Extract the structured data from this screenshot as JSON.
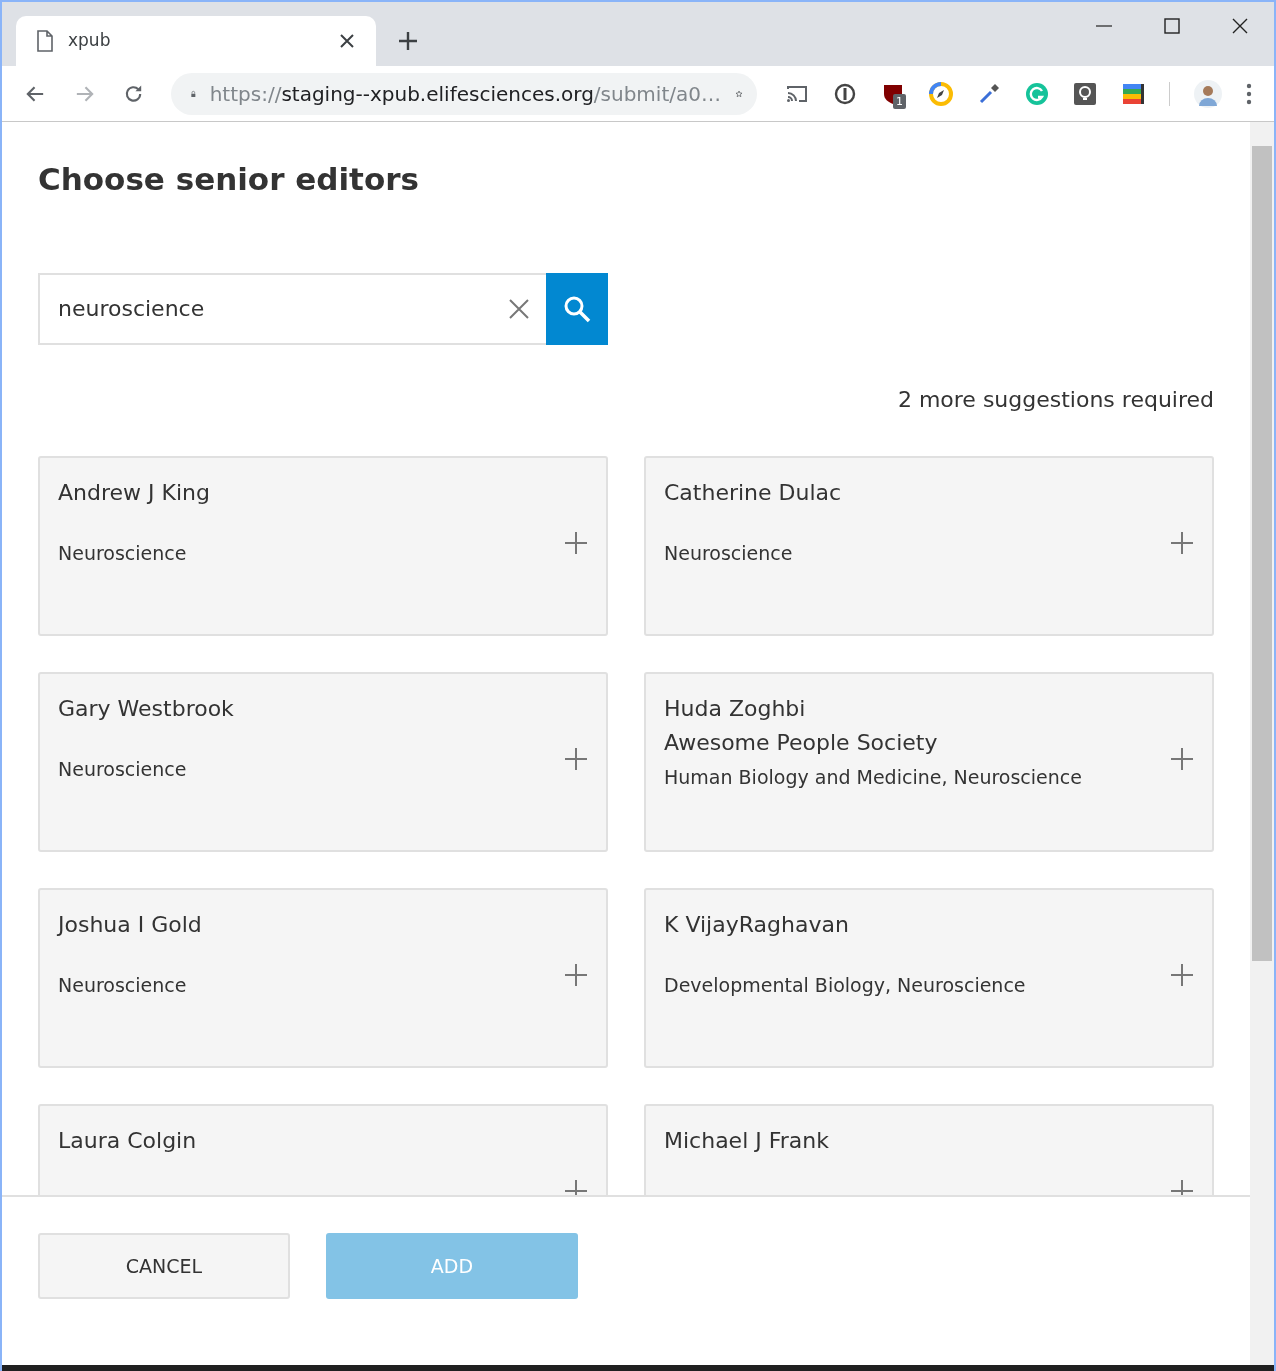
{
  "browser": {
    "tab": {
      "title": "xpub",
      "selected": true
    },
    "address": {
      "scheme": "https://",
      "host": "staging--xpub.elifesciences.org",
      "path": "/submit/a0…"
    },
    "extension_badge": "1"
  },
  "dialog": {
    "title": "Choose senior editors",
    "search": {
      "value": "neuroscience"
    },
    "requirement": "2 more suggestions required",
    "editors": [
      {
        "name": "Andrew J King",
        "lines": [
          "Neuroscience"
        ]
      },
      {
        "name": "Catherine Dulac",
        "lines": [
          "Neuroscience"
        ]
      },
      {
        "name": "Gary Westbrook",
        "lines": [
          "Neuroscience"
        ]
      },
      {
        "name": "Huda Zoghbi",
        "lines": [
          "Awesome People Society",
          "Human Biology and Medicine, Neuroscience"
        ]
      },
      {
        "name": "Joshua I Gold",
        "lines": [
          "Neuroscience"
        ]
      },
      {
        "name": "K VijayRaghavan",
        "lines": [
          "Developmental Biology, Neuroscience"
        ]
      },
      {
        "name": "Laura Colgin"
      },
      {
        "name": "Michael J Frank"
      }
    ],
    "buttons": [
      {
        "label": "CANCEL",
        "kind": "secondary",
        "disabled": false
      },
      {
        "label": "ADD",
        "kind": "primary",
        "disabled": true
      }
    ]
  }
}
